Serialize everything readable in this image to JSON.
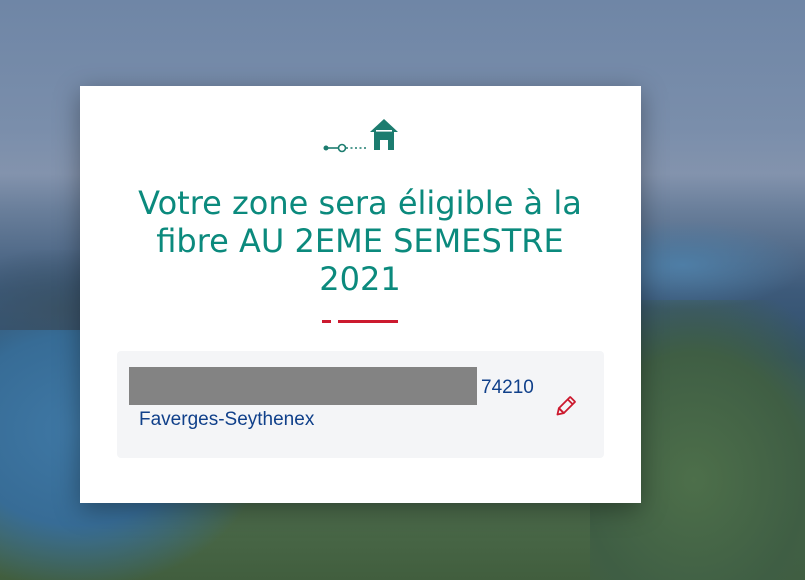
{
  "eligibility": {
    "title": "Votre zone sera éligible à la fibre AU 2EME SEMESTRE 2021"
  },
  "address": {
    "postcode": "74210",
    "city": "Faverges-Seythenex",
    "edit_icon": "pencil-icon"
  },
  "icons": {
    "progress": "home-icon"
  },
  "colors": {
    "title": "#0b8a7d",
    "accent": "#cc1a2f",
    "address_text": "#10408a",
    "address_bg": "#f4f5f7",
    "icon": "#1c7c6f"
  }
}
